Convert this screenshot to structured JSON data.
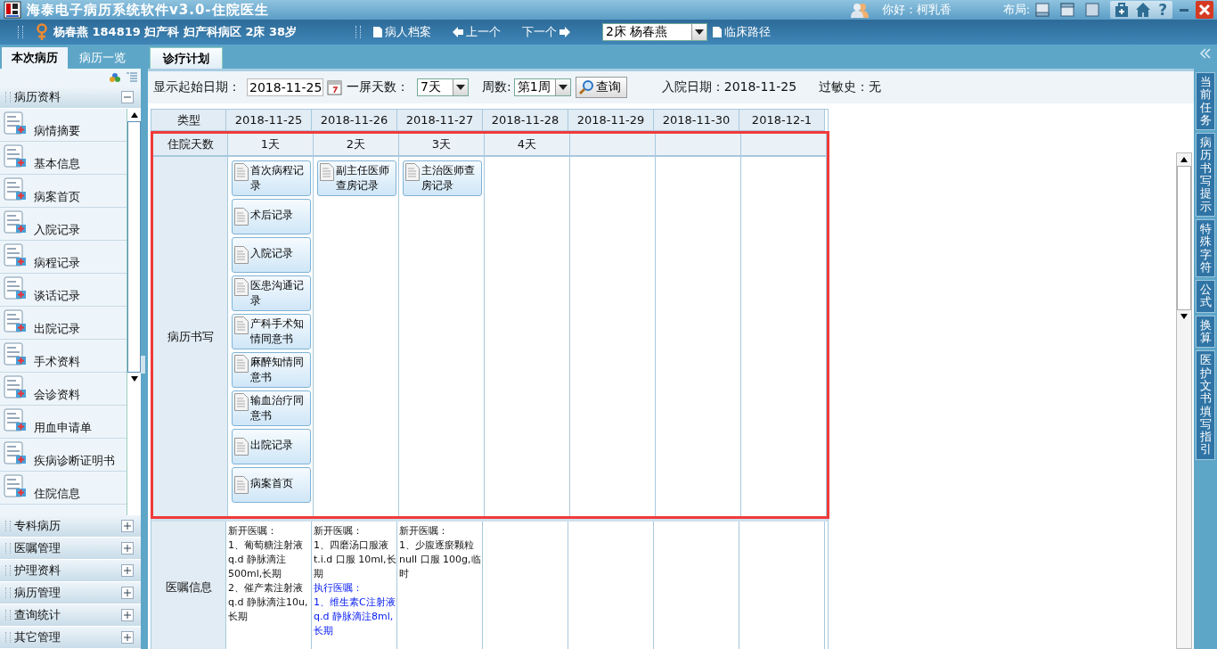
{
  "window": {
    "title": "海泰电子病历系统软件v3.0-住院医生",
    "greeting": "你好：柯乳香",
    "layout_label": "布局:",
    "help_button": "?"
  },
  "patient_bar": {
    "patient": "杨春燕 184819 妇产科 妇产科病区 2床 38岁",
    "links": [
      {
        "kind": "record",
        "label": "病人档案"
      },
      {
        "kind": "prev",
        "label": "上一个"
      },
      {
        "kind": "next",
        "label": "下一个"
      }
    ],
    "patient_select": "2床  杨春燕",
    "pathway_link": "临床路径"
  },
  "sidebar": {
    "tabs": [
      {
        "label": "本次病历",
        "selected": true
      },
      {
        "label": "病历一览",
        "selected": false
      }
    ],
    "sections": [
      {
        "title": "病历资料",
        "expanded": true,
        "items": [
          "病情摘要",
          "基本信息",
          "病案首页",
          "入院记录",
          "病程记录",
          "谈话记录",
          "出院记录",
          "手术资料",
          "会诊资料",
          "用血申请单",
          "疾病诊断证明书",
          "住院信息"
        ]
      },
      {
        "title": "专科病历",
        "expanded": false
      },
      {
        "title": "医嘱管理",
        "expanded": false
      },
      {
        "title": "护理资料",
        "expanded": false
      },
      {
        "title": "病历管理",
        "expanded": false
      },
      {
        "title": "查询统计",
        "expanded": false
      },
      {
        "title": "其它管理",
        "expanded": false
      }
    ]
  },
  "main_tabs": [
    {
      "label": "诊疗计划",
      "selected": true
    }
  ],
  "toolbar": {
    "start_date_label": "显示起始日期：",
    "start_date": "2018-11-25",
    "days_label": "一屏天数：",
    "days": "7天",
    "week_label": "周数:",
    "week": "第1周",
    "query_button": "查询",
    "admission": "入院日期：2018-11-25",
    "allergy": "过敏史：无"
  },
  "plan_table": {
    "columns": [
      "类型",
      "2018-11-25",
      "2018-11-26",
      "2018-11-27",
      "2018-11-28",
      "2018-11-29",
      "2018-11-30",
      "2018-12-1"
    ],
    "rows": [
      {
        "kind": "days",
        "highlighted": true,
        "cells": [
          "住院天数",
          "1天",
          "2天",
          "3天",
          "4天",
          "",
          "",
          ""
        ]
      },
      {
        "kind": "records",
        "highlighted": true,
        "cells": [
          "病历书写",
          [
            "首次病程记录",
            "术后记录",
            "入院记录",
            "医患沟通记录",
            "产科手术知情同意书",
            "麻醉知情同意书",
            "输血治疗同意书",
            "出院记录",
            "病案首页"
          ],
          [
            "副主任医师查房记录"
          ],
          [
            "主治医师查房记录"
          ],
          "",
          "",
          "",
          ""
        ]
      },
      {
        "kind": "orders",
        "highlighted": false,
        "cells": [
          "医嘱信息",
          [
            {
              "kind": "new",
              "text": "新开医嘱："
            },
            {
              "kind": "new",
              "text": "1、葡萄糖注射液q.d 静脉滴注500ml,长期"
            },
            {
              "kind": "new",
              "text": "2、催产素注射液q.d 静脉滴注10u,长期"
            }
          ],
          [
            {
              "kind": "new",
              "text": "新开医嘱："
            },
            {
              "kind": "new",
              "text": "1、四磨汤口服液t.i.d 口服  10ml,长期"
            },
            {
              "kind": "exec",
              "text": "执行医嘱："
            },
            {
              "kind": "exec",
              "text": "1、维生素C注射液  q.d 静脉滴注8ml,长期"
            }
          ],
          [
            {
              "kind": "new",
              "text": "新开医嘱："
            },
            {
              "kind": "new",
              "text": "1、少腹逐瘀颗粒null 口服  100g,临时"
            }
          ],
          "",
          "",
          "",
          ""
        ]
      }
    ]
  },
  "side_tabs": [
    "当前任务",
    "病历书写提示",
    "特殊字符",
    "公式",
    "换算",
    "医护文书填写指引"
  ]
}
